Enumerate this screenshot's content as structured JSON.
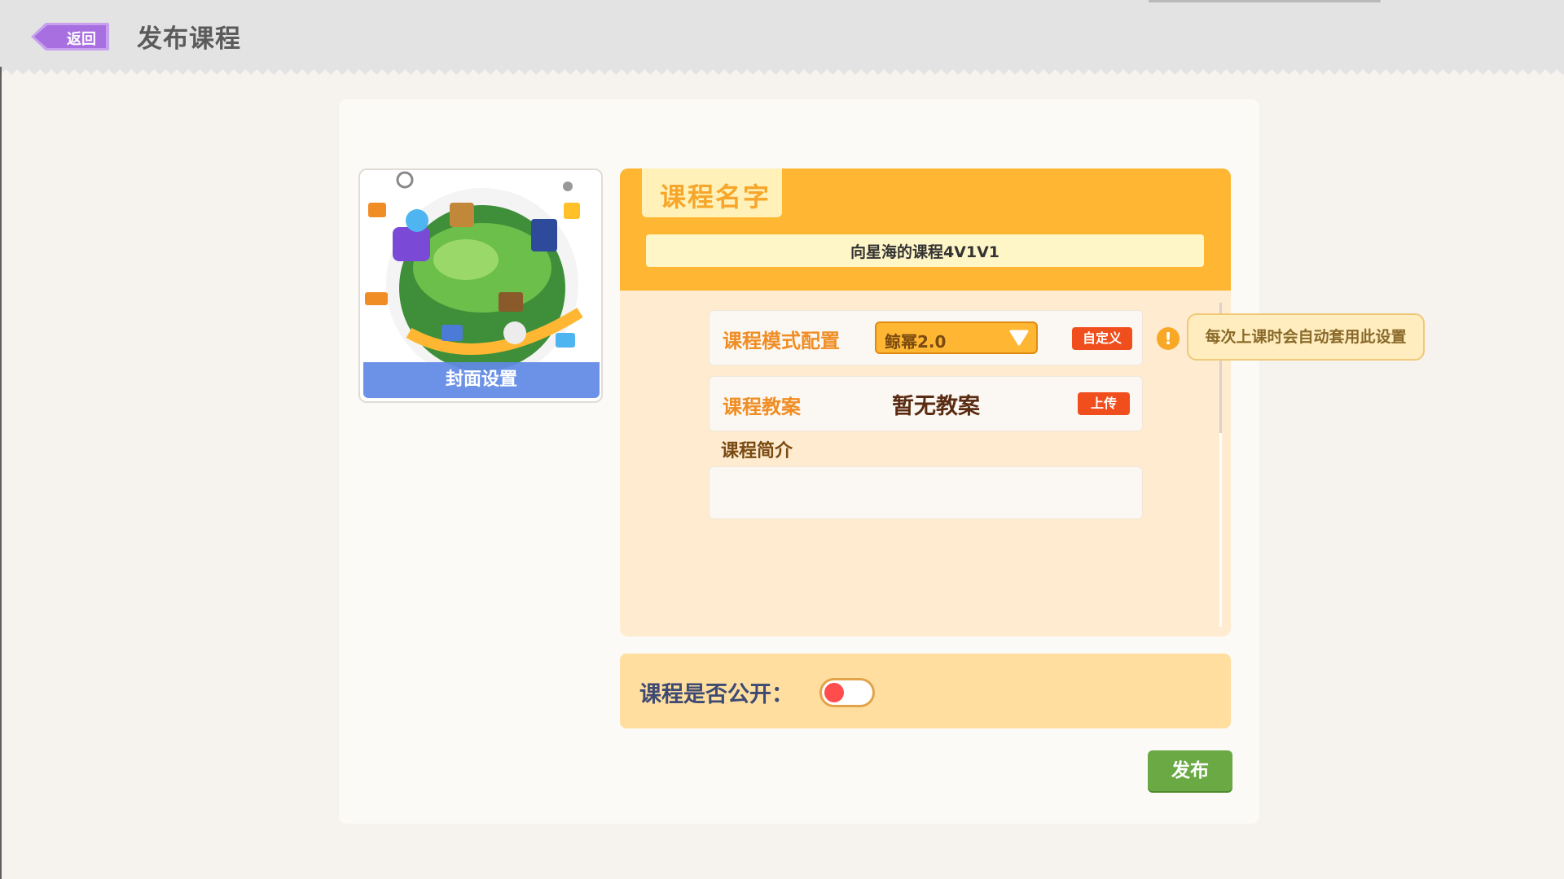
{
  "header": {
    "back_label": "返回",
    "title": "发布课程"
  },
  "cover": {
    "button_label": "封面设置"
  },
  "course_name": {
    "tab_label": "课程名字",
    "value": "向星海的课程4V1V1"
  },
  "mode": {
    "label": "课程模式配置",
    "selected": "鲸幂2.0",
    "custom_label": "自定义",
    "tooltip": "每次上课时会自动套用此设置",
    "warn_glyph": "!"
  },
  "plan": {
    "label": "课程教案",
    "value": "暂无教案",
    "upload_label": "上传"
  },
  "intro": {
    "label": "课程简介",
    "value": ""
  },
  "public": {
    "label": "课程是否公开：",
    "enabled": false
  },
  "publish_label": "发布",
  "colors": {
    "accent_orange": "#ffb733",
    "red_action": "#f04e1d",
    "publish_green": "#6aa944",
    "cover_blue": "#6089e6"
  }
}
